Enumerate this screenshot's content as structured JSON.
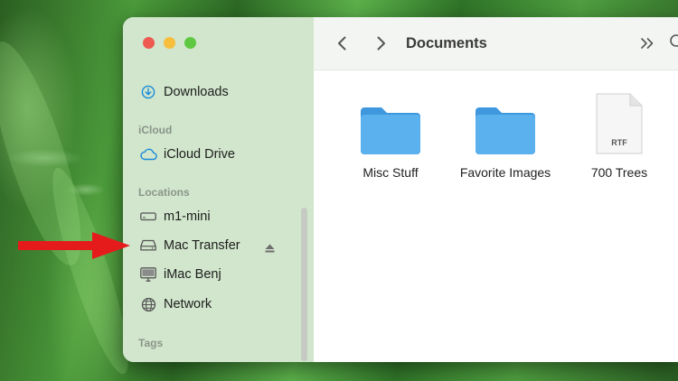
{
  "window": {
    "title": "Documents"
  },
  "sidebar": {
    "favorites": [
      {
        "label": "Downloads",
        "icon": "download-circle-icon"
      }
    ],
    "icloud": {
      "header": "iCloud",
      "items": [
        {
          "label": "iCloud Drive",
          "icon": "cloud-icon"
        }
      ]
    },
    "locations": {
      "header": "Locations",
      "items": [
        {
          "label": "m1-mini",
          "icon": "hard-drive-icon"
        },
        {
          "label": "Mac Transfer",
          "icon": "external-drive-icon"
        },
        {
          "label": "iMac Benj",
          "icon": "monitor-icon"
        },
        {
          "label": "Network",
          "icon": "globe-icon"
        }
      ]
    },
    "tags": {
      "header": "Tags"
    }
  },
  "files": [
    {
      "name": "Misc Stuff",
      "kind": "folder"
    },
    {
      "name": "Favorite Images",
      "kind": "folder"
    },
    {
      "name": "700 Trees",
      "kind": "document",
      "badge": "RTF"
    }
  ],
  "colors": {
    "accent": "#1a8ad8",
    "folder": "#5bb1ee",
    "arrow": "#e51b1b",
    "close": "#ee5a52",
    "minimize": "#f6be3b",
    "maximize": "#5ec842"
  }
}
